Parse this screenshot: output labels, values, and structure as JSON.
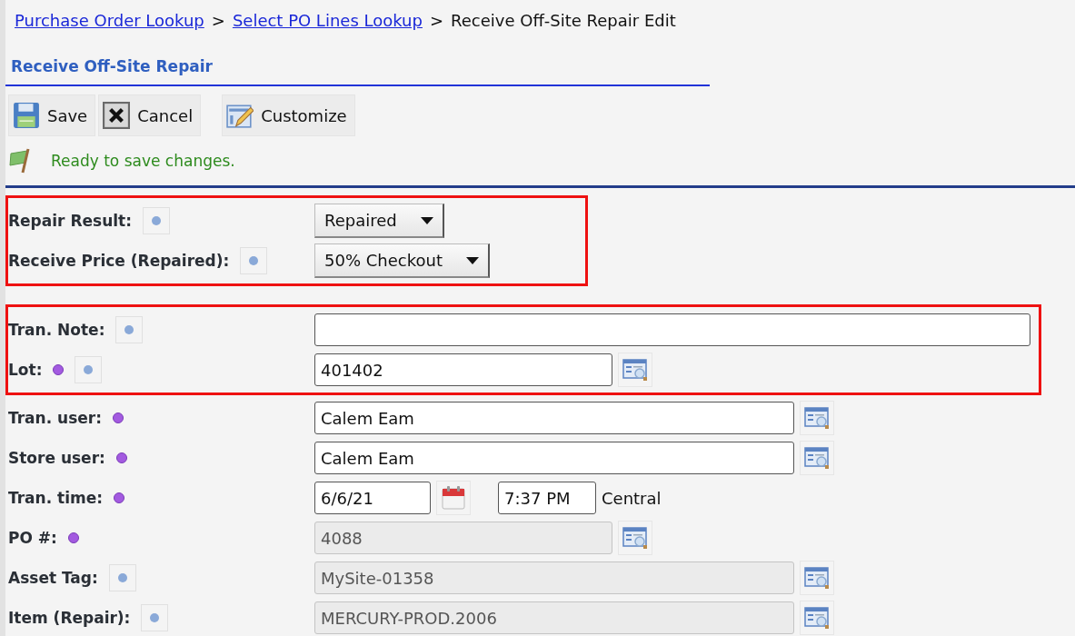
{
  "breadcrumb": [
    {
      "label": "Purchase Order Lookup",
      "link": true
    },
    {
      "label": "Select PO Lines Lookup",
      "link": true
    },
    {
      "label": "Receive Off-Site Repair Edit",
      "link": false
    }
  ],
  "breadcrumb_separator": ">",
  "title": "Receive Off-Site Repair",
  "toolbar": [
    {
      "label": "Save",
      "kind": "save"
    },
    {
      "label": "Cancel",
      "kind": "cancel"
    },
    {
      "label": "Customize",
      "kind": "customize"
    }
  ],
  "status": {
    "message": "Ready to save changes."
  },
  "sections": [
    {
      "highlighted": true,
      "fields": [
        {
          "label": "Repair Result:",
          "kind": "select",
          "required": false,
          "help": true,
          "value": "Repaired",
          "disabled": false,
          "lookup": false
        },
        {
          "label": "Receive Price (Repaired):",
          "kind": "select",
          "required": false,
          "help": true,
          "value": "50% Checkout",
          "disabled": false,
          "lookup": false
        }
      ]
    },
    {
      "highlighted": true,
      "fields": [
        {
          "label": "Tran. Note:",
          "kind": "text",
          "short": false,
          "required": false,
          "help": true,
          "disabled": false,
          "lookup": false
        },
        {
          "label": "Lot:",
          "kind": "text",
          "short": true,
          "required": true,
          "help": true,
          "value": "401402",
          "disabled": false,
          "lookup": true
        }
      ]
    },
    {
      "highlighted": false,
      "fields": [
        {
          "label": "Tran. user:",
          "kind": "text",
          "short": false,
          "required": true,
          "help": false,
          "value": "Calem Eam",
          "disabled": false,
          "lookup": true
        },
        {
          "label": "Store user:",
          "kind": "text",
          "short": false,
          "required": true,
          "help": false,
          "value": "Calem Eam",
          "disabled": false,
          "lookup": true
        },
        {
          "label": "Tran. time:",
          "kind": "datetime",
          "required": true,
          "help": false,
          "value": "6/6/21",
          "time": "7:37 PM",
          "zone": "Central",
          "disabled": false,
          "lookup": false
        },
        {
          "label": "PO #:",
          "kind": "text",
          "short": true,
          "required": true,
          "help": false,
          "value": "4088",
          "disabled": true,
          "lookup": true
        },
        {
          "label": "Asset Tag:",
          "kind": "text",
          "short": false,
          "required": false,
          "help": true,
          "value": "MySite-01358",
          "disabled": true,
          "lookup": true
        },
        {
          "label": "Item (Repair):",
          "kind": "text",
          "short": false,
          "required": false,
          "help": true,
          "value": "MERCURY-PROD.2006",
          "disabled": true,
          "lookup": true
        }
      ]
    }
  ]
}
